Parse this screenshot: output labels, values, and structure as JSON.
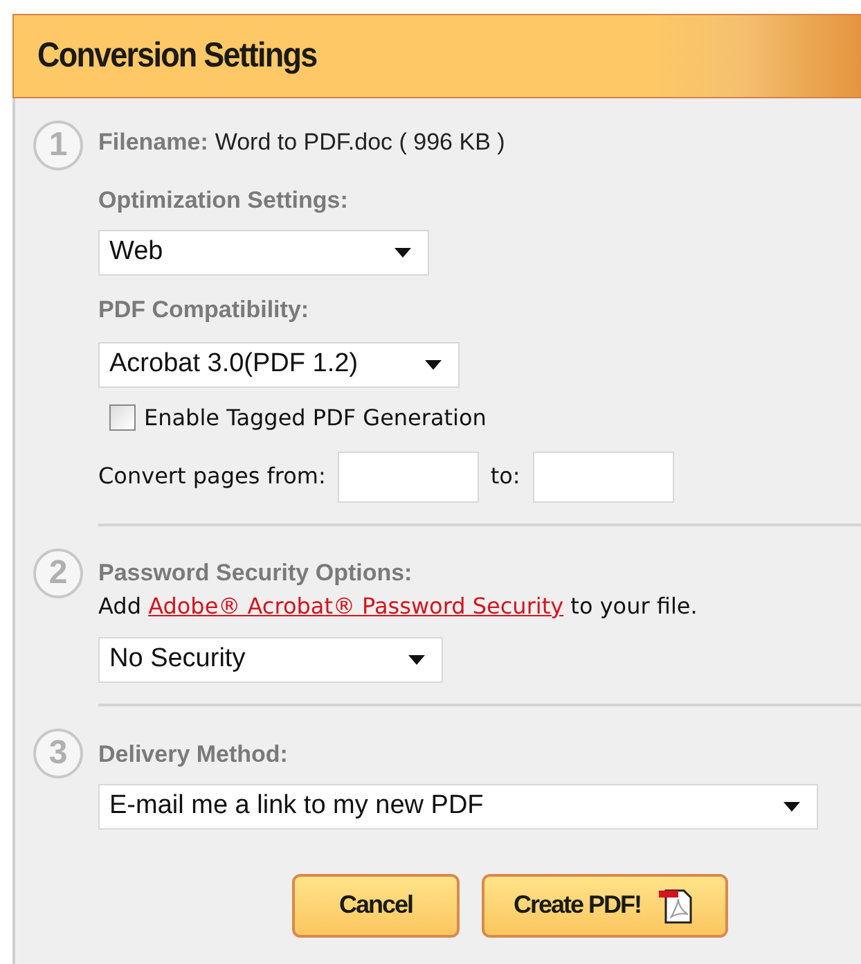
{
  "panel": {
    "title": "Conversion Settings"
  },
  "steps": [
    {
      "number": "1",
      "filename_label": "Filename:",
      "filename": "Word to PDF.doc ( 996 KB )",
      "optimization_label": "Optimization Settings:",
      "optimization": "Web",
      "compatibility_label": "PDF Compatibility:",
      "compatibility": "Acrobat 3.0(PDF 1.2)",
      "tagged_pdf": {
        "label": "Enable Tagged PDF Generation",
        "checked": false
      },
      "pages_label": "Convert pages from:",
      "to_label": "to:"
    },
    {
      "number": "2",
      "label": "Password Security Options:",
      "note": {
        "prefix": "Add",
        "link": "Adobe® Acrobat® Password Security",
        "suffix": "to your file."
      },
      "security": "No Security"
    },
    {
      "number": "3",
      "label": "Delivery Method:",
      "delivery": "E-mail me a link to my new PDF"
    }
  ],
  "buttons": [
    {
      "label": "Cancel",
      "kind": "plain"
    },
    {
      "label": "Create PDF!",
      "kind": "pdf"
    }
  ]
}
